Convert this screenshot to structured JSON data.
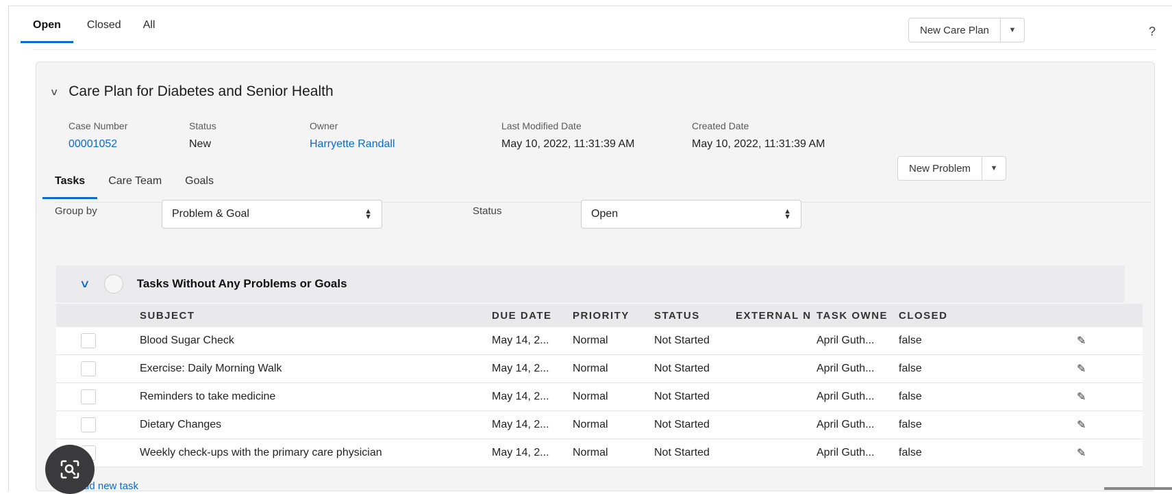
{
  "top_tabs": [
    {
      "label": "Open",
      "active": true
    },
    {
      "label": "Closed",
      "active": false
    },
    {
      "label": "All",
      "active": false
    }
  ],
  "new_care_plan": {
    "label": "New Care Plan"
  },
  "help": "?",
  "care_plan": {
    "title": "Care Plan for Diabetes and Senior Health",
    "fields": {
      "case_number": {
        "label": "Case Number",
        "value": "00001052"
      },
      "status": {
        "label": "Status",
        "value": "New"
      },
      "owner": {
        "label": "Owner",
        "value": "Harryette Randall"
      },
      "last_modified": {
        "label": "Last Modified Date",
        "value": "May 10, 2022, 11:31:39 AM"
      },
      "created": {
        "label": "Created Date",
        "value": "May 10, 2022, 11:31:39 AM"
      }
    }
  },
  "sub_tabs": [
    {
      "label": "Tasks",
      "active": true
    },
    {
      "label": "Care Team",
      "active": false
    },
    {
      "label": "Goals",
      "active": false
    }
  ],
  "new_problem": {
    "label": "New Problem"
  },
  "filters": {
    "group_by": {
      "label": "Group by",
      "value": "Problem & Goal"
    },
    "status": {
      "label": "Status",
      "value": "Open"
    }
  },
  "group": {
    "title": "Tasks Without Any Problems or Goals"
  },
  "table": {
    "headers": [
      "SUBJECT",
      "DUE DATE",
      "PRIORITY",
      "STATUS",
      "EXTERNAL N",
      "TASK OWNE",
      "CLOSED"
    ],
    "rows": [
      [
        "Blood Sugar Check",
        "May 14, 2...",
        "Normal",
        "Not Started",
        "",
        "April Guth...",
        "false"
      ],
      [
        "Exercise: Daily Morning Walk",
        "May 14, 2...",
        "Normal",
        "Not Started",
        "",
        "April Guth...",
        "false"
      ],
      [
        "Reminders to take medicine",
        "May 14, 2...",
        "Normal",
        "Not Started",
        "",
        "April Guth...",
        "false"
      ],
      [
        "Dietary Changes",
        "May 14, 2...",
        "Normal",
        "Not Started",
        "",
        "April Guth...",
        "false"
      ],
      [
        "Weekly check-ups with the primary care physician",
        "May 14, 2...",
        "Normal",
        "Not Started",
        "",
        "April Guth...",
        "false"
      ]
    ]
  },
  "add_task": "Add new task",
  "icons": {
    "edit": "pencil-icon",
    "lens": "screenshot-lens-icon"
  },
  "colors": {
    "accent": "#0b6bcb",
    "card_bg": "#f4f4f5"
  }
}
